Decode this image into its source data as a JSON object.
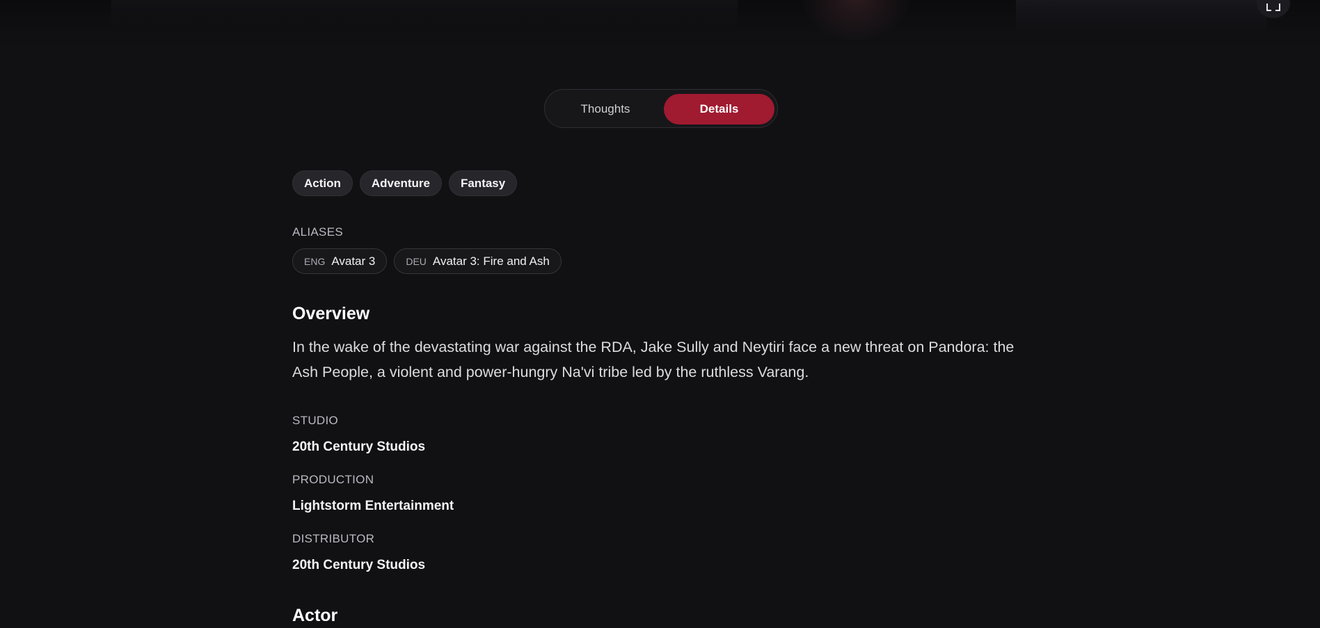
{
  "tabs": {
    "thoughts_label": "Thoughts",
    "details_label": "Details",
    "active": "Details"
  },
  "genres": [
    "Action",
    "Adventure",
    "Fantasy"
  ],
  "aliases": {
    "label": "ALIASES",
    "items": [
      {
        "lang": "ENG",
        "name": "Avatar 3"
      },
      {
        "lang": "DEU",
        "name": "Avatar 3: Fire and Ash"
      }
    ]
  },
  "overview": {
    "heading": "Overview",
    "text": "In the wake of the devastating war against the RDA, Jake Sully and Neytiri face a new threat on Pandora: the Ash People, a violent and power-hungry Na'vi tribe led by the ruthless Varang."
  },
  "studio": {
    "label": "STUDIO",
    "value": "20th Century Studios"
  },
  "production": {
    "label": "PRODUCTION",
    "value": "Lightstorm Entertainment"
  },
  "distributor": {
    "label": "DISTRIBUTOR",
    "value": "20th Century Studios"
  },
  "actor": {
    "heading": "Actor"
  },
  "icons": {
    "fullscreen": "fullscreen-icon"
  },
  "colors": {
    "background": "#111114",
    "accent": "#a01a30",
    "chip": "#26262b"
  }
}
